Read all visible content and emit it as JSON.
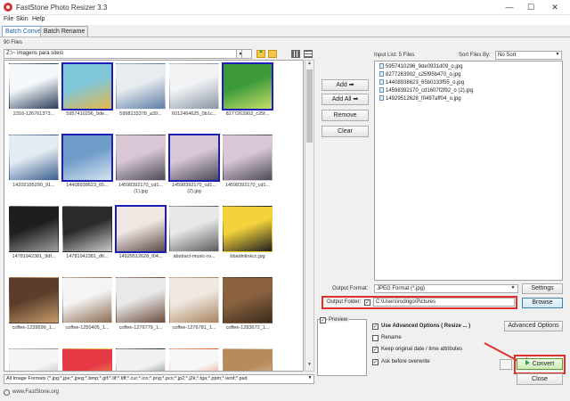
{
  "window": {
    "title": "FastStone Photo Resizer 3.3",
    "min": "—",
    "max": "☐",
    "close": "✕"
  },
  "menu": [
    "File",
    "Skin",
    "Help"
  ],
  "tabs": [
    "Batch Convert",
    "Batch Rename"
  ],
  "files_count": "90 Files",
  "path": "Z:\\~ imagens para sites\\",
  "thumbnails": [
    {
      "label": "2316-1267613?3...",
      "selected": false,
      "colors": [
        "#f5f8fb",
        "#2a3d5a"
      ]
    },
    {
      "label": "5957410296_9de...",
      "selected": true,
      "colors": [
        "#7fc6d9",
        "#e6b84a"
      ]
    },
    {
      "label": "5998133378_a39...",
      "selected": false,
      "colors": [
        "#e9ecef",
        "#5b7da6"
      ]
    },
    {
      "label": "6012464625_0b1c...",
      "selected": false,
      "colors": [
        "#f1f3f5",
        "#8a95a5"
      ]
    },
    {
      "label": "8277263902_c25f...",
      "selected": true,
      "colors": [
        "#3d9a3a",
        "#c6e06a"
      ]
    },
    {
      "label": "14202195290_91...",
      "selected": false,
      "colors": [
        "#e4ecf3",
        "#3a5f8e"
      ]
    },
    {
      "label": "14408938623_65...",
      "selected": true,
      "colors": [
        "#6f9cc9",
        "#d8e4ef"
      ]
    },
    {
      "label": "14598392170_cd1...\n(1).jpg",
      "selected": false,
      "colors": [
        "#d9c7d6",
        "#4a4a55"
      ]
    },
    {
      "label": "14598392170_cd1...\n(2).jpg",
      "selected": true,
      "colors": [
        "#d9c7d6",
        "#4a4a55"
      ]
    },
    {
      "label": "14598392170_cd1...",
      "selected": false,
      "colors": [
        "#d9c7d6",
        "#4a4a55"
      ]
    },
    {
      "label": "14781942381_9df...",
      "selected": false,
      "colors": [
        "#1e1e1e",
        "#9e9e9e"
      ]
    },
    {
      "label": "14781942381_d6...",
      "selected": false,
      "colors": [
        "#2a2a2a",
        "#c9c9c9"
      ]
    },
    {
      "label": "14929512628_f04...",
      "selected": true,
      "colors": [
        "#f0e6e2",
        "#5b4a48"
      ]
    },
    {
      "label": "abstract-music-ro...",
      "selected": false,
      "colors": [
        "#e8e8e8",
        "#5c5c5c"
      ]
    },
    {
      "label": "bbadinlinkcc.jpg",
      "selected": false,
      "colors": [
        "#f3d23c",
        "#1e1e1e"
      ]
    },
    {
      "label": "coffee-1239599_1...",
      "selected": false,
      "colors": [
        "#5a3e2b",
        "#c89a6a"
      ]
    },
    {
      "label": "coffee-1250405_1...",
      "selected": false,
      "colors": [
        "#f4f4f4",
        "#8b6b4f"
      ]
    },
    {
      "label": "coffee-1276779_1...",
      "selected": false,
      "colors": [
        "#e9e9e9",
        "#6d4c3d"
      ]
    },
    {
      "label": "coffee-1276781_1...",
      "selected": false,
      "colors": [
        "#efe9e2",
        "#a8845e"
      ]
    },
    {
      "label": "coffee-1283672_1...",
      "selected": false,
      "colors": [
        "#8a6240",
        "#3a2a1c"
      ]
    },
    {
      "label": "",
      "selected": false,
      "colors": [
        "#f5f5f5",
        "#8f8f8f"
      ]
    },
    {
      "label": "",
      "selected": false,
      "colors": [
        "#e63946",
        "#f4d35e"
      ]
    },
    {
      "label": "",
      "selected": false,
      "colors": [
        "#f1f1f1",
        "#2b2b2b"
      ]
    },
    {
      "label": "",
      "selected": false,
      "colors": [
        "#f7f7f7",
        "#e05a2b"
      ]
    },
    {
      "label": "",
      "selected": false,
      "colors": [
        "#b88a5c",
        "#e9e2d5"
      ]
    }
  ],
  "filter": "All Image Formats (*.jpg;*.jpe;*.jpeg;*.bmp;*.gif;*.tif;*.tiff;*.cur;*.ico;*.png;*.pcx;*.jp2;*.j2k;*.tga;*.ppm;*.wmf;*.psd",
  "status": "www.FastStone.org",
  "buttons": {
    "add": "Add ➡",
    "add_all": "Add All ➡",
    "remove": "Remove",
    "clear": "Clear",
    "settings": "Settings",
    "browse": "Browse",
    "advanced": "Advanced Options",
    "convert": "Convert",
    "close": "Close"
  },
  "input_list": {
    "label": "Input List:  5 Files",
    "sort_label": "Sort Files By:",
    "sort_value": "No Sort",
    "items": [
      "5957410296_9de0931d09_o.jpg",
      "8277263902_c25f95b470_o.jpg",
      "14408938623_65b0133f55_o.jpg",
      "14598392170_cd1607f2f92_o (2).jpg",
      "14929512628_f0497aff04_o.jpg"
    ]
  },
  "output": {
    "format_label": "Output Format:",
    "format_value": "JPEG Format (*.jpg)",
    "folder_label": "Output Folder:",
    "folder_checked": "✓",
    "folder_value": "C:\\Users\\rodrigo\\Pictures"
  },
  "preview": {
    "label": "Preview",
    "checked": "✓"
  },
  "options": {
    "use_advanced": "Use Advanced Options ( Resize ... )",
    "rename": "Rename",
    "keep_date": "Keep original date / time attributes",
    "ask_overwrite": "Ask before overwrite",
    "check": "✓"
  },
  "accent": {
    "highlight": "#e03131",
    "selection": "#1d1db8"
  }
}
